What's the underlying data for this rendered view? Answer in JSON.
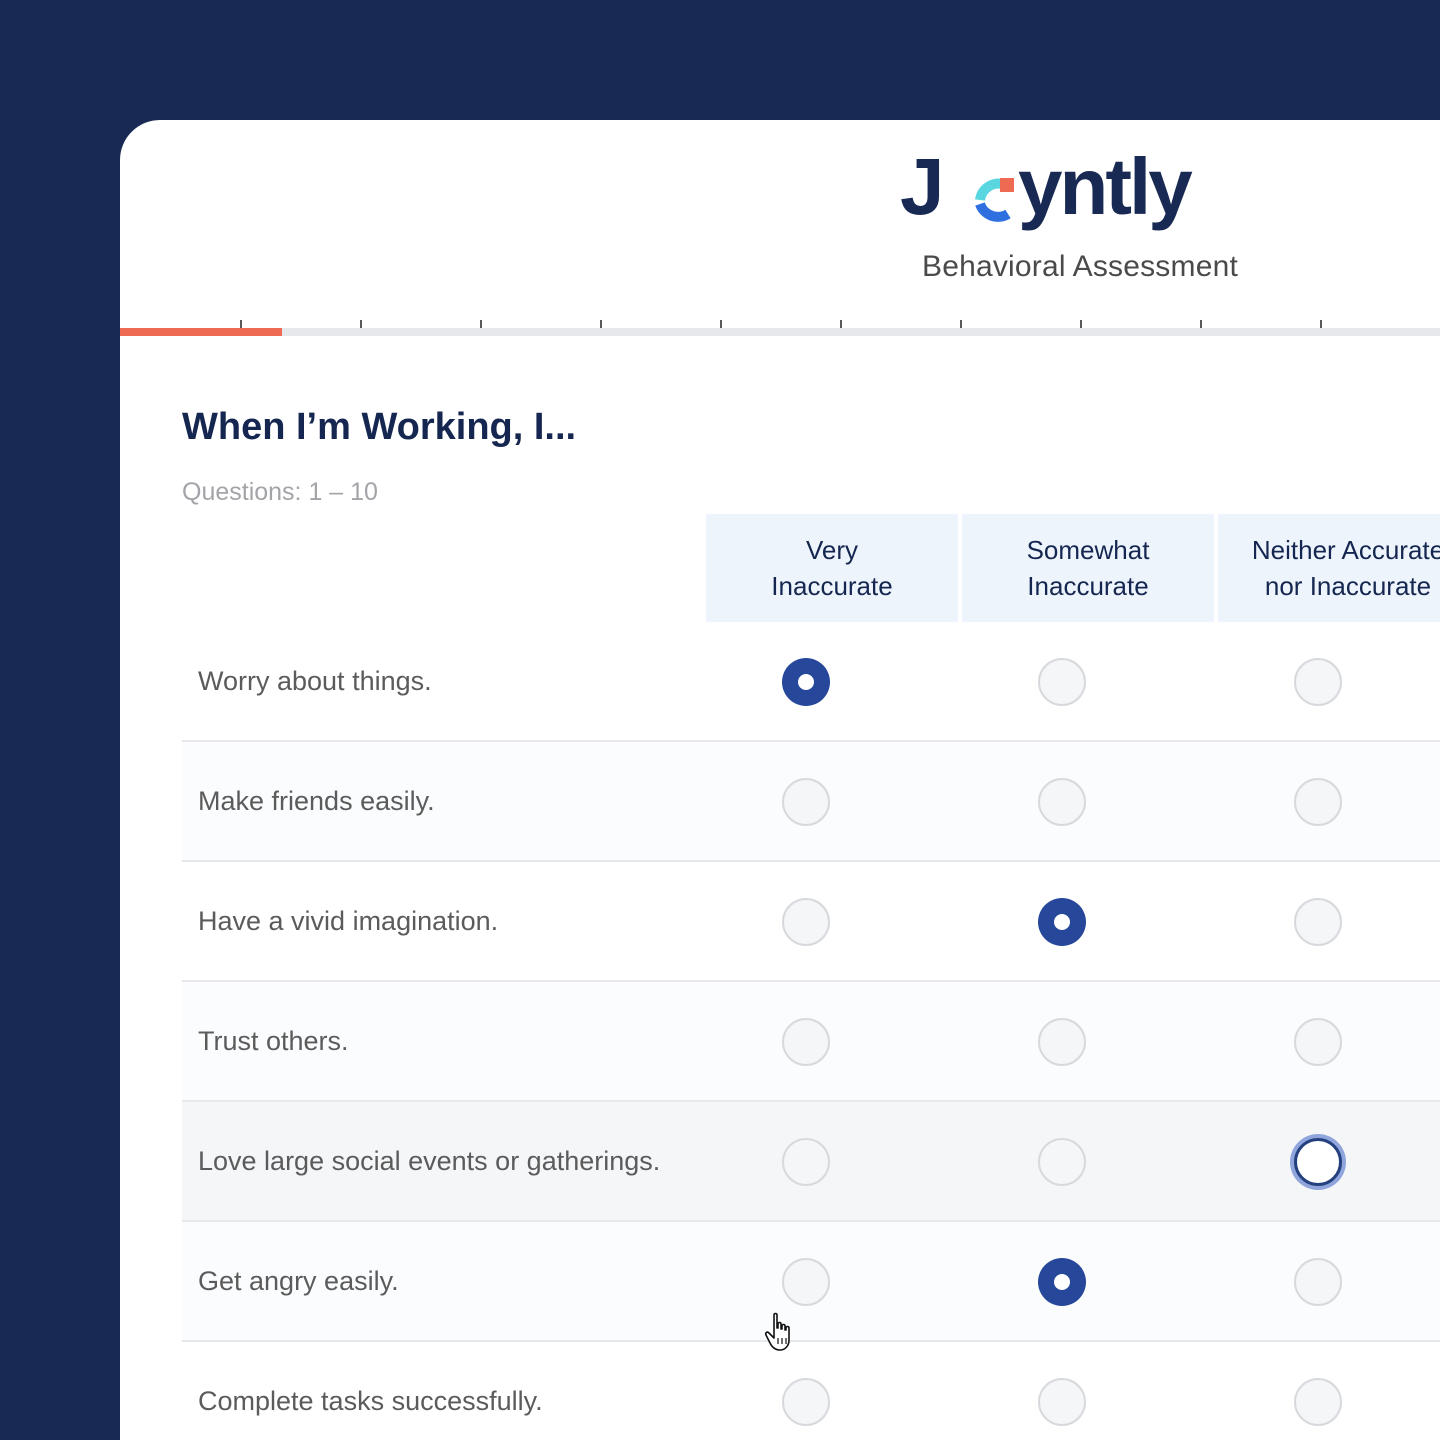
{
  "brand": {
    "name": "Joyntly",
    "colors": {
      "navy": "#182a53",
      "accent_red": "#ee6a52",
      "accent_teal": "#5ad6e0",
      "accent_blue": "#2f6fe0",
      "radio_selected": "#26479a"
    }
  },
  "header": {
    "subtitle": "Behavioral Assessment"
  },
  "progress": {
    "filled_fraction": 0.123,
    "steps": 11
  },
  "section": {
    "heading": "When I’m Working, I...",
    "question_range": "Questions: 1 – 10"
  },
  "columns": [
    "Very\nInaccurate",
    "Somewhat\nInaccurate",
    "Neither Accurate\nnor Inaccurate"
  ],
  "rows": [
    {
      "text": "Worry about things.",
      "selected": 0
    },
    {
      "text": "Make friends easily.",
      "selected": null
    },
    {
      "text": "Have a vivid imagination.",
      "selected": 1
    },
    {
      "text": "Trust others.",
      "selected": null
    },
    {
      "text": "Love large social events or gatherings.",
      "selected": null,
      "focused": 2
    },
    {
      "text": "Get angry easily.",
      "selected": 1
    },
    {
      "text": "Complete tasks successfully.",
      "selected": null
    }
  ],
  "icons": {
    "cursor": "hand-pointer-icon"
  }
}
